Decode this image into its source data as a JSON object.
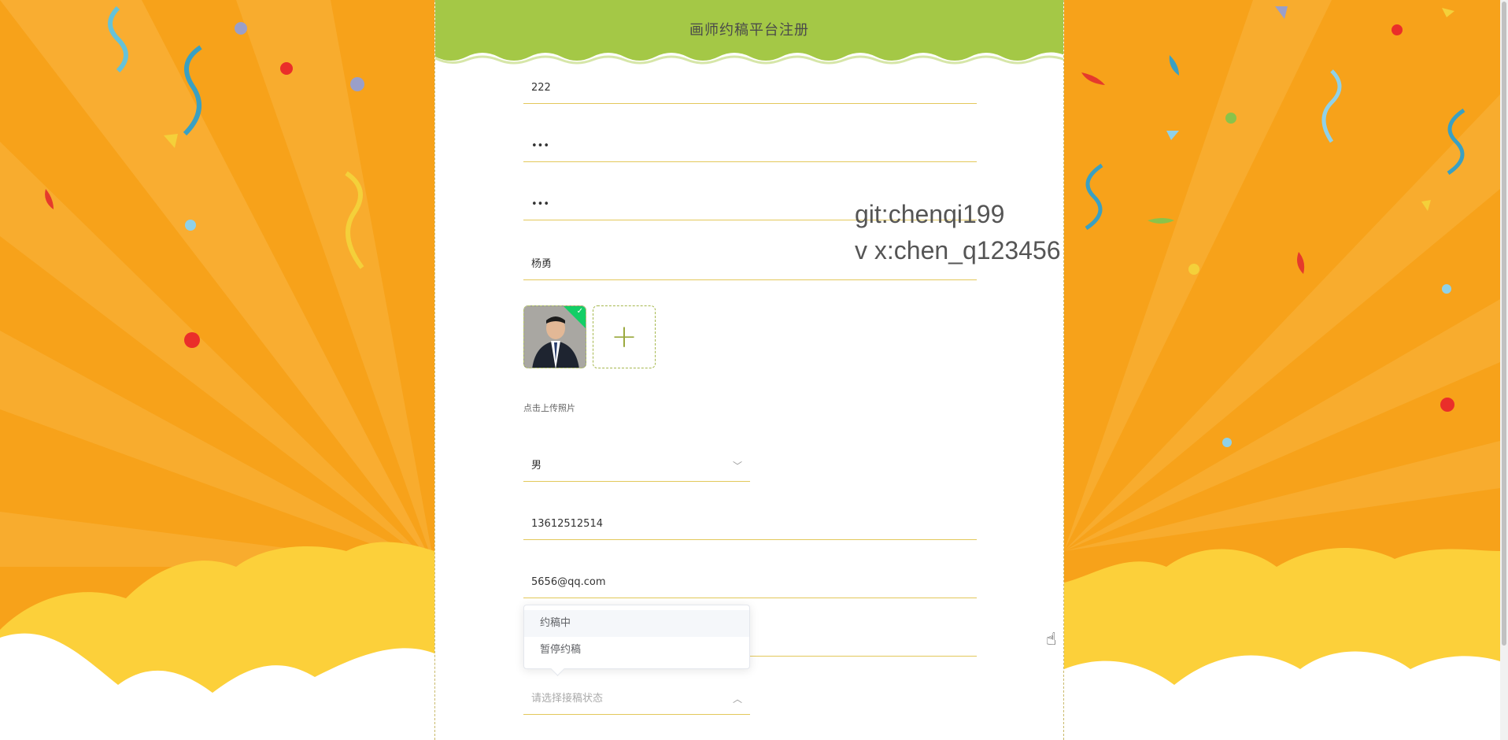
{
  "header": {
    "title": "画师约稿平台注册"
  },
  "form": {
    "account": "222",
    "password": "•••",
    "confirm_password": "•••",
    "name": "杨勇",
    "upload_hint": "点击上传照片",
    "gender": "男",
    "phone": "13612512514",
    "email": "5656@qq.com",
    "status_placeholder": "请选择接稿状态"
  },
  "dropdown": {
    "options": [
      "约稿中",
      "暂停约稿"
    ]
  },
  "watermark": {
    "line1": "git:chenqi199",
    "line2": "v x:chen_q123456"
  },
  "colors": {
    "header_green": "#a4c846",
    "field_underline": "#e3c85b",
    "bg_orange": "#f7a21a",
    "cloud_yellow": "#fcd03a"
  }
}
